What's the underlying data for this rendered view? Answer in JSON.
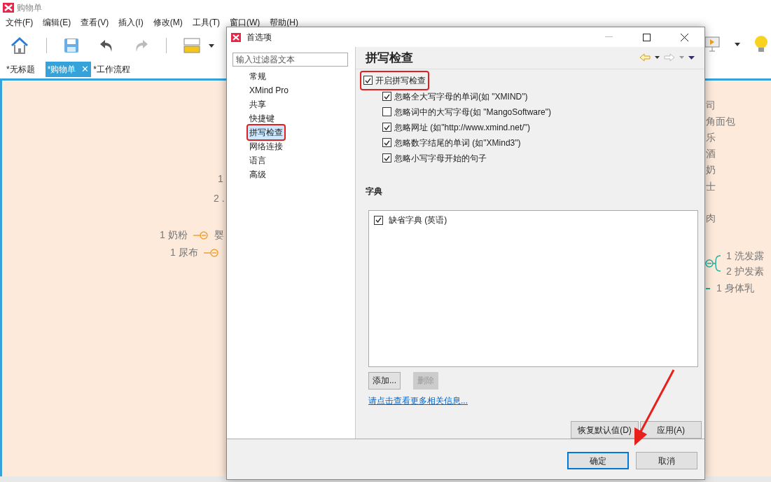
{
  "app": {
    "title": "购物单"
  },
  "menu": [
    "文件(F)",
    "编辑(E)",
    "查看(V)",
    "插入(I)",
    "修改(M)",
    "工具(T)",
    "窗口(W)",
    "帮助(H)"
  ],
  "tabs": [
    {
      "label": "*无标题",
      "selected": false
    },
    {
      "label": "*购物单",
      "selected": true,
      "close": "✕"
    },
    {
      "label": "*工作流程",
      "selected": false
    }
  ],
  "canvas_left": [
    {
      "text": "1",
      "kind": "plain"
    },
    {
      "text": "2 .",
      "kind": "plain"
    },
    {
      "text": "1 奶粉",
      "kind": "branch",
      "tail": "婴"
    },
    {
      "text": "1 尿布",
      "kind": "branch"
    }
  ],
  "canvas_right": [
    {
      "text": "司",
      "kind": "plain"
    },
    {
      "text": "角面包",
      "kind": "plain"
    },
    {
      "text": "乐",
      "kind": "plain"
    },
    {
      "text": "酒",
      "kind": "plain"
    },
    {
      "text": "奶",
      "kind": "plain"
    },
    {
      "text": "士",
      "kind": "plain"
    },
    {
      "text": "肉",
      "kind": "plain"
    },
    {
      "text": "1 洗发露",
      "kind": "bracket"
    },
    {
      "text": "2 护发素",
      "kind": "bracket"
    },
    {
      "text": "1 身体乳",
      "kind": "line"
    }
  ],
  "dialog": {
    "title": "首选项",
    "filter": {
      "placeholder": "输入过滤器文本"
    },
    "nav": [
      {
        "label": "常规",
        "selected": false,
        "highlighted": false
      },
      {
        "label": "XMind Pro",
        "selected": false,
        "highlighted": false
      },
      {
        "label": "共享",
        "selected": false,
        "highlighted": false
      },
      {
        "label": "快捷键",
        "selected": false,
        "highlighted": false
      },
      {
        "label": "拼写检查",
        "selected": true,
        "highlighted": true
      },
      {
        "label": "网络连接",
        "selected": false,
        "highlighted": false
      },
      {
        "label": "语言",
        "selected": false,
        "highlighted": false
      },
      {
        "label": "高级",
        "selected": false,
        "highlighted": false
      }
    ],
    "heading": "拼写检查",
    "enable": {
      "label": "开启拼写检查",
      "checked": true,
      "highlighted": true
    },
    "options": [
      {
        "label": "忽略全大写字母的单词(如 \"XMIND\")",
        "checked": true
      },
      {
        "label": "忽略词中的大写字母(如 \"MangoSoftware\")",
        "checked": false
      },
      {
        "label": "忽略网址 (如\"http://www.xmind.net/\")",
        "checked": true
      },
      {
        "label": "忽略数字结尾的单词 (如\"XMind3\")",
        "checked": true
      },
      {
        "label": "忽略小写字母开始的句子",
        "checked": true
      }
    ],
    "dict_heading": "字典",
    "dictionaries": [
      {
        "label": "缺省字典 (英语)",
        "checked": true
      }
    ],
    "add": {
      "label": "添加...",
      "disabled": false
    },
    "remove": {
      "label": "删除",
      "disabled": true
    },
    "link": "请点击查看更多相关信息...",
    "restore": "恢复默认值(D)",
    "apply": "应用(A)",
    "ok": "确定",
    "cancel": "取消"
  }
}
